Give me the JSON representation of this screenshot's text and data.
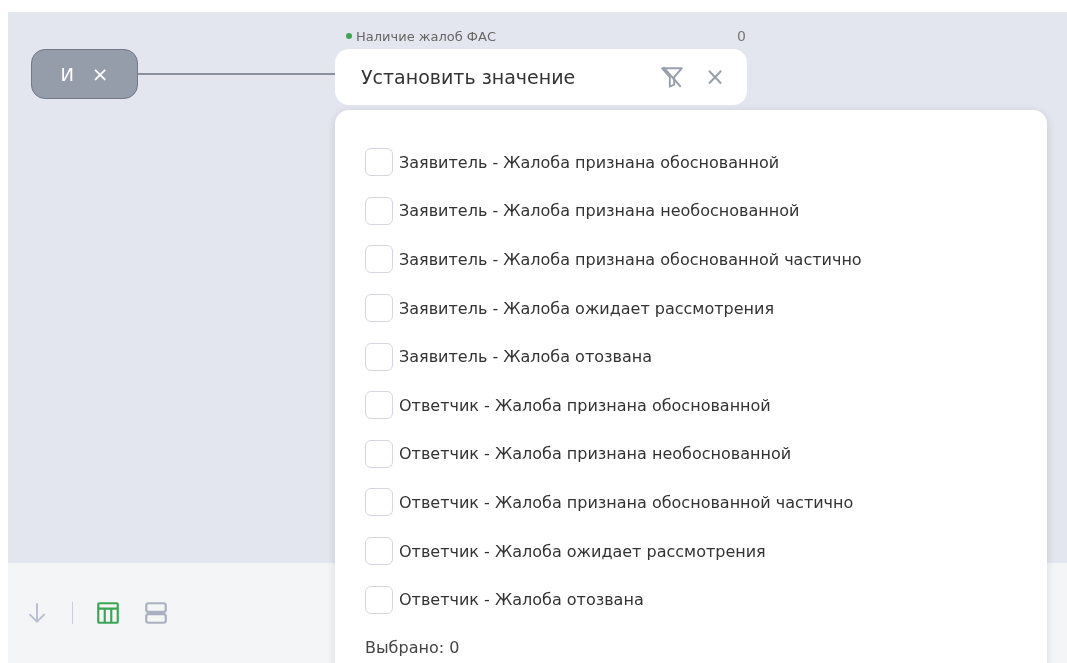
{
  "operator_node": {
    "label": "И",
    "remove": "×"
  },
  "condition": {
    "field": "Наличие жалоб ФАС",
    "count": "0",
    "value_placeholder": "Установить значение",
    "remove": "×"
  },
  "options": [
    {
      "label": "Заявитель - Жалоба признана обоснованной",
      "checked": false
    },
    {
      "label": "Заявитель - Жалоба признана необоснованной",
      "checked": false
    },
    {
      "label": "Заявитель - Жалоба признана обоснованной частично",
      "checked": false
    },
    {
      "label": "Заявитель - Жалоба ожидает рассмотрения",
      "checked": false
    },
    {
      "label": "Заявитель - Жалоба отозвана",
      "checked": false
    },
    {
      "label": "Ответчик - Жалоба признана обоснованной",
      "checked": false
    },
    {
      "label": "Ответчик - Жалоба признана необоснованной",
      "checked": false
    },
    {
      "label": "Ответчик - Жалоба признана обоснованной частично",
      "checked": false
    },
    {
      "label": "Ответчик - Жалоба ожидает рассмотрения",
      "checked": false
    },
    {
      "label": "Ответчик - Жалоба отозвана",
      "checked": false
    }
  ],
  "selected_count": "Выбрано: 0",
  "view_modes": [
    {
      "kind": "table",
      "selected": true
    },
    {
      "kind": "list",
      "selected": false
    }
  ]
}
